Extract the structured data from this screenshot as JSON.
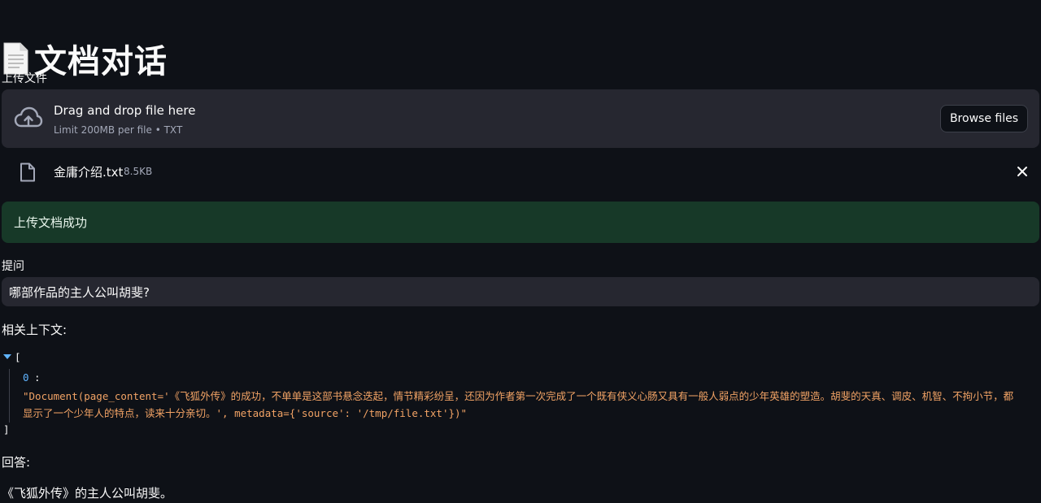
{
  "app": {
    "title": "文档对话",
    "title_icon": "page-facing-up-icon"
  },
  "upload": {
    "label": "上传文件",
    "drop_text": "Drag and drop file here",
    "limit_text": "Limit 200MB per file • TXT",
    "browse_label": "Browse files",
    "icon": "cloud-upload-icon"
  },
  "uploaded_file": {
    "name": "金庸介绍.txt",
    "size": "8.5KB",
    "icon": "file-icon",
    "remove_icon": "close-icon"
  },
  "status": {
    "message": "上传文档成功",
    "color": "#173928"
  },
  "question": {
    "label": "提问",
    "value": "哪部作品的主人公叫胡斐?"
  },
  "context": {
    "label": "相关上下文:",
    "open_bracket": "[",
    "close_bracket": "]",
    "items": [
      {
        "index": "0",
        "value": "\"Document(page_content='《飞狐外传》的成功，不单单是这部书悬念迭起，情节精彩纷呈，还因为作者第一次完成了一个既有侠义心肠又具有一般人弱点的少年英雄的塑造。胡斐的天真、调皮、机智、不拘小节，都显示了一个少年人的特点，读来十分亲切。', metadata={'source': '/tmp/file.txt'})\""
      }
    ]
  },
  "answer": {
    "label": "回答:",
    "text": "《飞狐外传》的主人公叫胡斐。"
  },
  "colors": {
    "background": "#0e1117",
    "surface": "#262730",
    "string": "#f2a365",
    "key": "#60b4ff"
  }
}
